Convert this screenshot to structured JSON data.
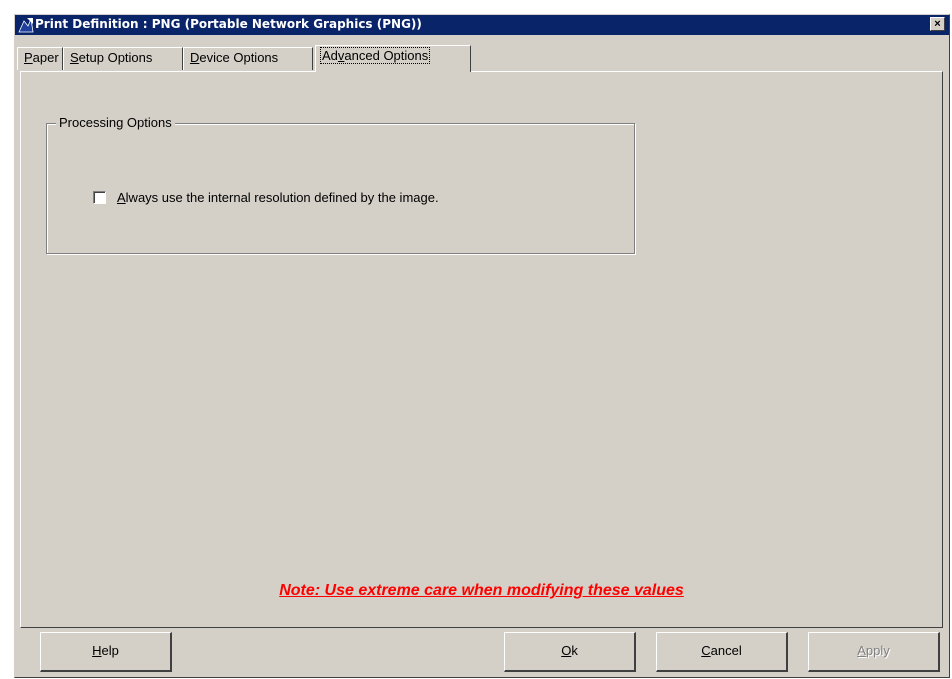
{
  "window": {
    "title": "Print Definition : PNG (Portable Network Graphics (PNG))",
    "close_label": "×"
  },
  "tabs": [
    {
      "pre": "",
      "key": "P",
      "post": "aper"
    },
    {
      "pre": "",
      "key": "S",
      "post": "etup Options"
    },
    {
      "pre": "",
      "key": "D",
      "post": "evice Options"
    },
    {
      "pre": "Ad",
      "key": "v",
      "post": "anced Options"
    }
  ],
  "active_tab": "Advanced Options",
  "processing_options": {
    "group_label": "Processing Options",
    "checkbox": {
      "pre": "",
      "key": "A",
      "post": "lways use the internal resolution defined by the image.",
      "checked": false
    }
  },
  "note": "Note: Use extreme care when modifying these values",
  "buttons": {
    "help": {
      "pre": "",
      "key": "H",
      "post": "elp"
    },
    "ok": {
      "pre": "",
      "key": "O",
      "post": "k"
    },
    "cancel": {
      "pre": "",
      "key": "C",
      "post": "ancel"
    },
    "apply": {
      "pre": "",
      "key": "A",
      "post": "pply",
      "enabled": false
    }
  },
  "colors": {
    "titlebar": "#0a246a",
    "face": "#d4d0c8",
    "note": "#ff0000"
  }
}
